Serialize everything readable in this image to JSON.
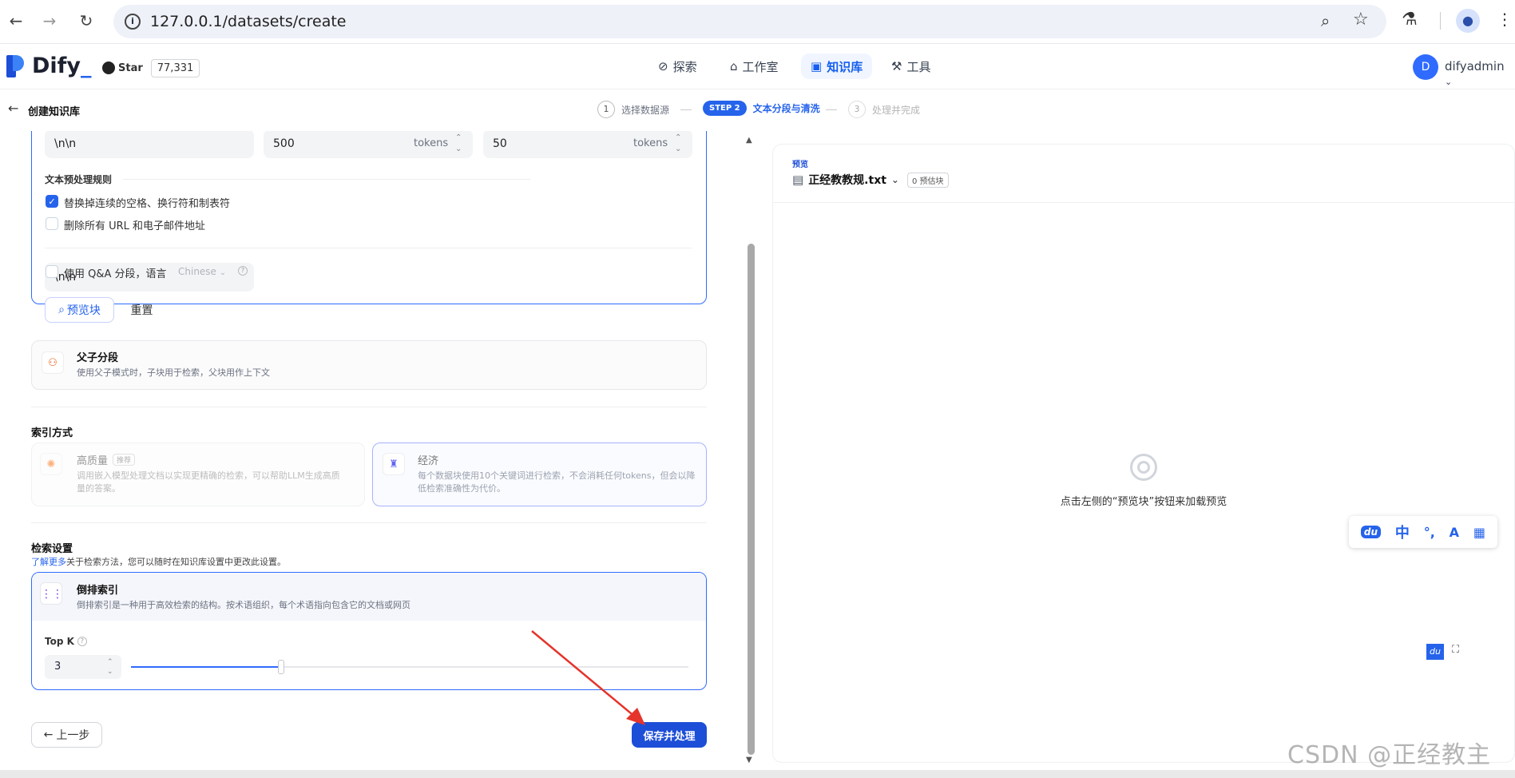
{
  "browser": {
    "url": "127.0.0.1/datasets/create"
  },
  "header": {
    "logo": "Dify",
    "github_star": "Star",
    "github_count": "77,331",
    "nav": [
      "探索",
      "工作室",
      "知识库",
      "工具"
    ],
    "active_nav": "知识库",
    "avatar_letter": "D",
    "username": "difyadmin"
  },
  "subheader": {
    "back_title": "创建知识库",
    "steps": [
      {
        "num": "1",
        "label": "选择数据源"
      },
      {
        "num": "STEP 2",
        "label": "文本分段与清洗"
      },
      {
        "num": "3",
        "label": "处理并完成"
      }
    ]
  },
  "segment": {
    "separator_value": "\\n\\n",
    "max_length": "500",
    "overlap": "50",
    "tokens_unit": "tokens",
    "rules_title": "文本预处理规则",
    "rule_replace": "替换掉连续的空格、换行符和制表符",
    "rule_delete_url": "删除所有 URL 和电子邮件地址",
    "qa_label": "使用 Q&A 分段，语言",
    "qa_language": "Chinese",
    "preview_button": "预览块",
    "reset_button": "重置"
  },
  "parent_child": {
    "title": "父子分段",
    "desc": "使用父子模式时，子块用于检索，父块用作上下文"
  },
  "index": {
    "section_title": "索引方式",
    "high_quality_title": "高质量",
    "high_quality_badge": "推荐",
    "high_quality_desc": "调用嵌入模型处理文档以实现更精确的检索，可以帮助LLM生成高质量的答案。",
    "economy_title": "经济",
    "economy_desc": "每个数据块使用10个关键词进行检索，不会消耗任何tokens，但会以降低检索准确性为代价。"
  },
  "retrieval": {
    "section_title": "检索设置",
    "learn_more": "了解更多",
    "learn_more_suffix": "关于检索方法，您可以随时在知识库设置中更改此设置。",
    "method_title": "倒排索引",
    "method_desc": "倒排索引是一种用于高效检索的结构。按术语组织，每个术语指向包含它的文档或网页",
    "topk_label": "Top K",
    "topk_value": "3",
    "topk_fraction": 0.27
  },
  "footer": {
    "prev_button": "上一步",
    "save_button": "保存并处理"
  },
  "preview": {
    "label": "预览",
    "filename": "正经教教规.txt",
    "chunk_badge": "0 预估块",
    "empty_hint": "点击左侧的“预览块”按钮来加载预览"
  },
  "ime_toolbar": {
    "items": [
      "du",
      "中",
      "°,",
      "A",
      "▦"
    ]
  },
  "watermark": "CSDN @正经教主",
  "colors": {
    "primary": "#155eef",
    "save_button": "#1d4ed8",
    "arrow": "#e5342b"
  }
}
